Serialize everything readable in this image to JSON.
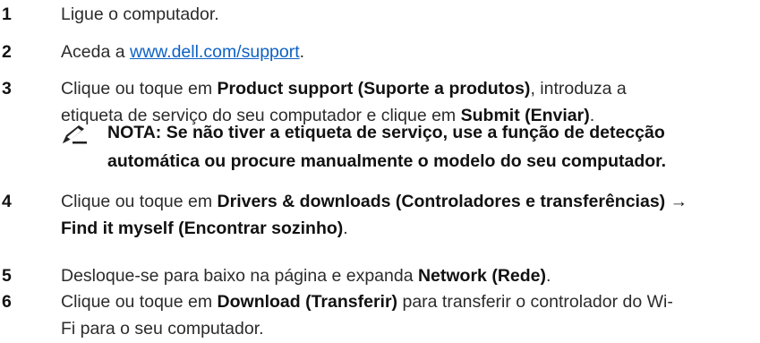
{
  "steps": [
    {
      "num": "1",
      "text": "Ligue o computador."
    },
    {
      "num": "2",
      "text_before": "Aceda a ",
      "link": "www.dell.com/support",
      "text_after": "."
    },
    {
      "num": "3",
      "pre": "Clique ou toque em ",
      "bold1": "Product support (Suporte a produtos)",
      "mid": ", introduza a",
      "line2_pre": "etiqueta de serviço do seu computador e clique em ",
      "bold2": "Submit (Enviar)",
      "post": "."
    },
    {
      "num": "4",
      "pre": "Clique ou toque em ",
      "bold1": "Drivers & downloads (Controladores e transferências) →",
      "bold2": "Find it myself (Encontrar sozinho)",
      "post": "."
    },
    {
      "num": "5",
      "pre": "Desloque-se para baixo na página e expanda ",
      "bold": "Network (Rede)",
      "post": "."
    },
    {
      "num": "6",
      "pre": "Clique ou toque em ",
      "bold": "Download (Transferir)",
      "mid": " para transferir o controlador do Wi-",
      "line2": "Fi para o seu computador."
    }
  ],
  "note": {
    "line1": "NOTA: Se não tiver a etiqueta de serviço, use a função de detecção",
    "line2": "automática ou procure manualmente o modelo do seu computador.",
    "icon": "pencil-note-icon"
  },
  "colors": {
    "text": "#2b2b2b",
    "bold": "#111111",
    "link": "#0e62c4"
  }
}
